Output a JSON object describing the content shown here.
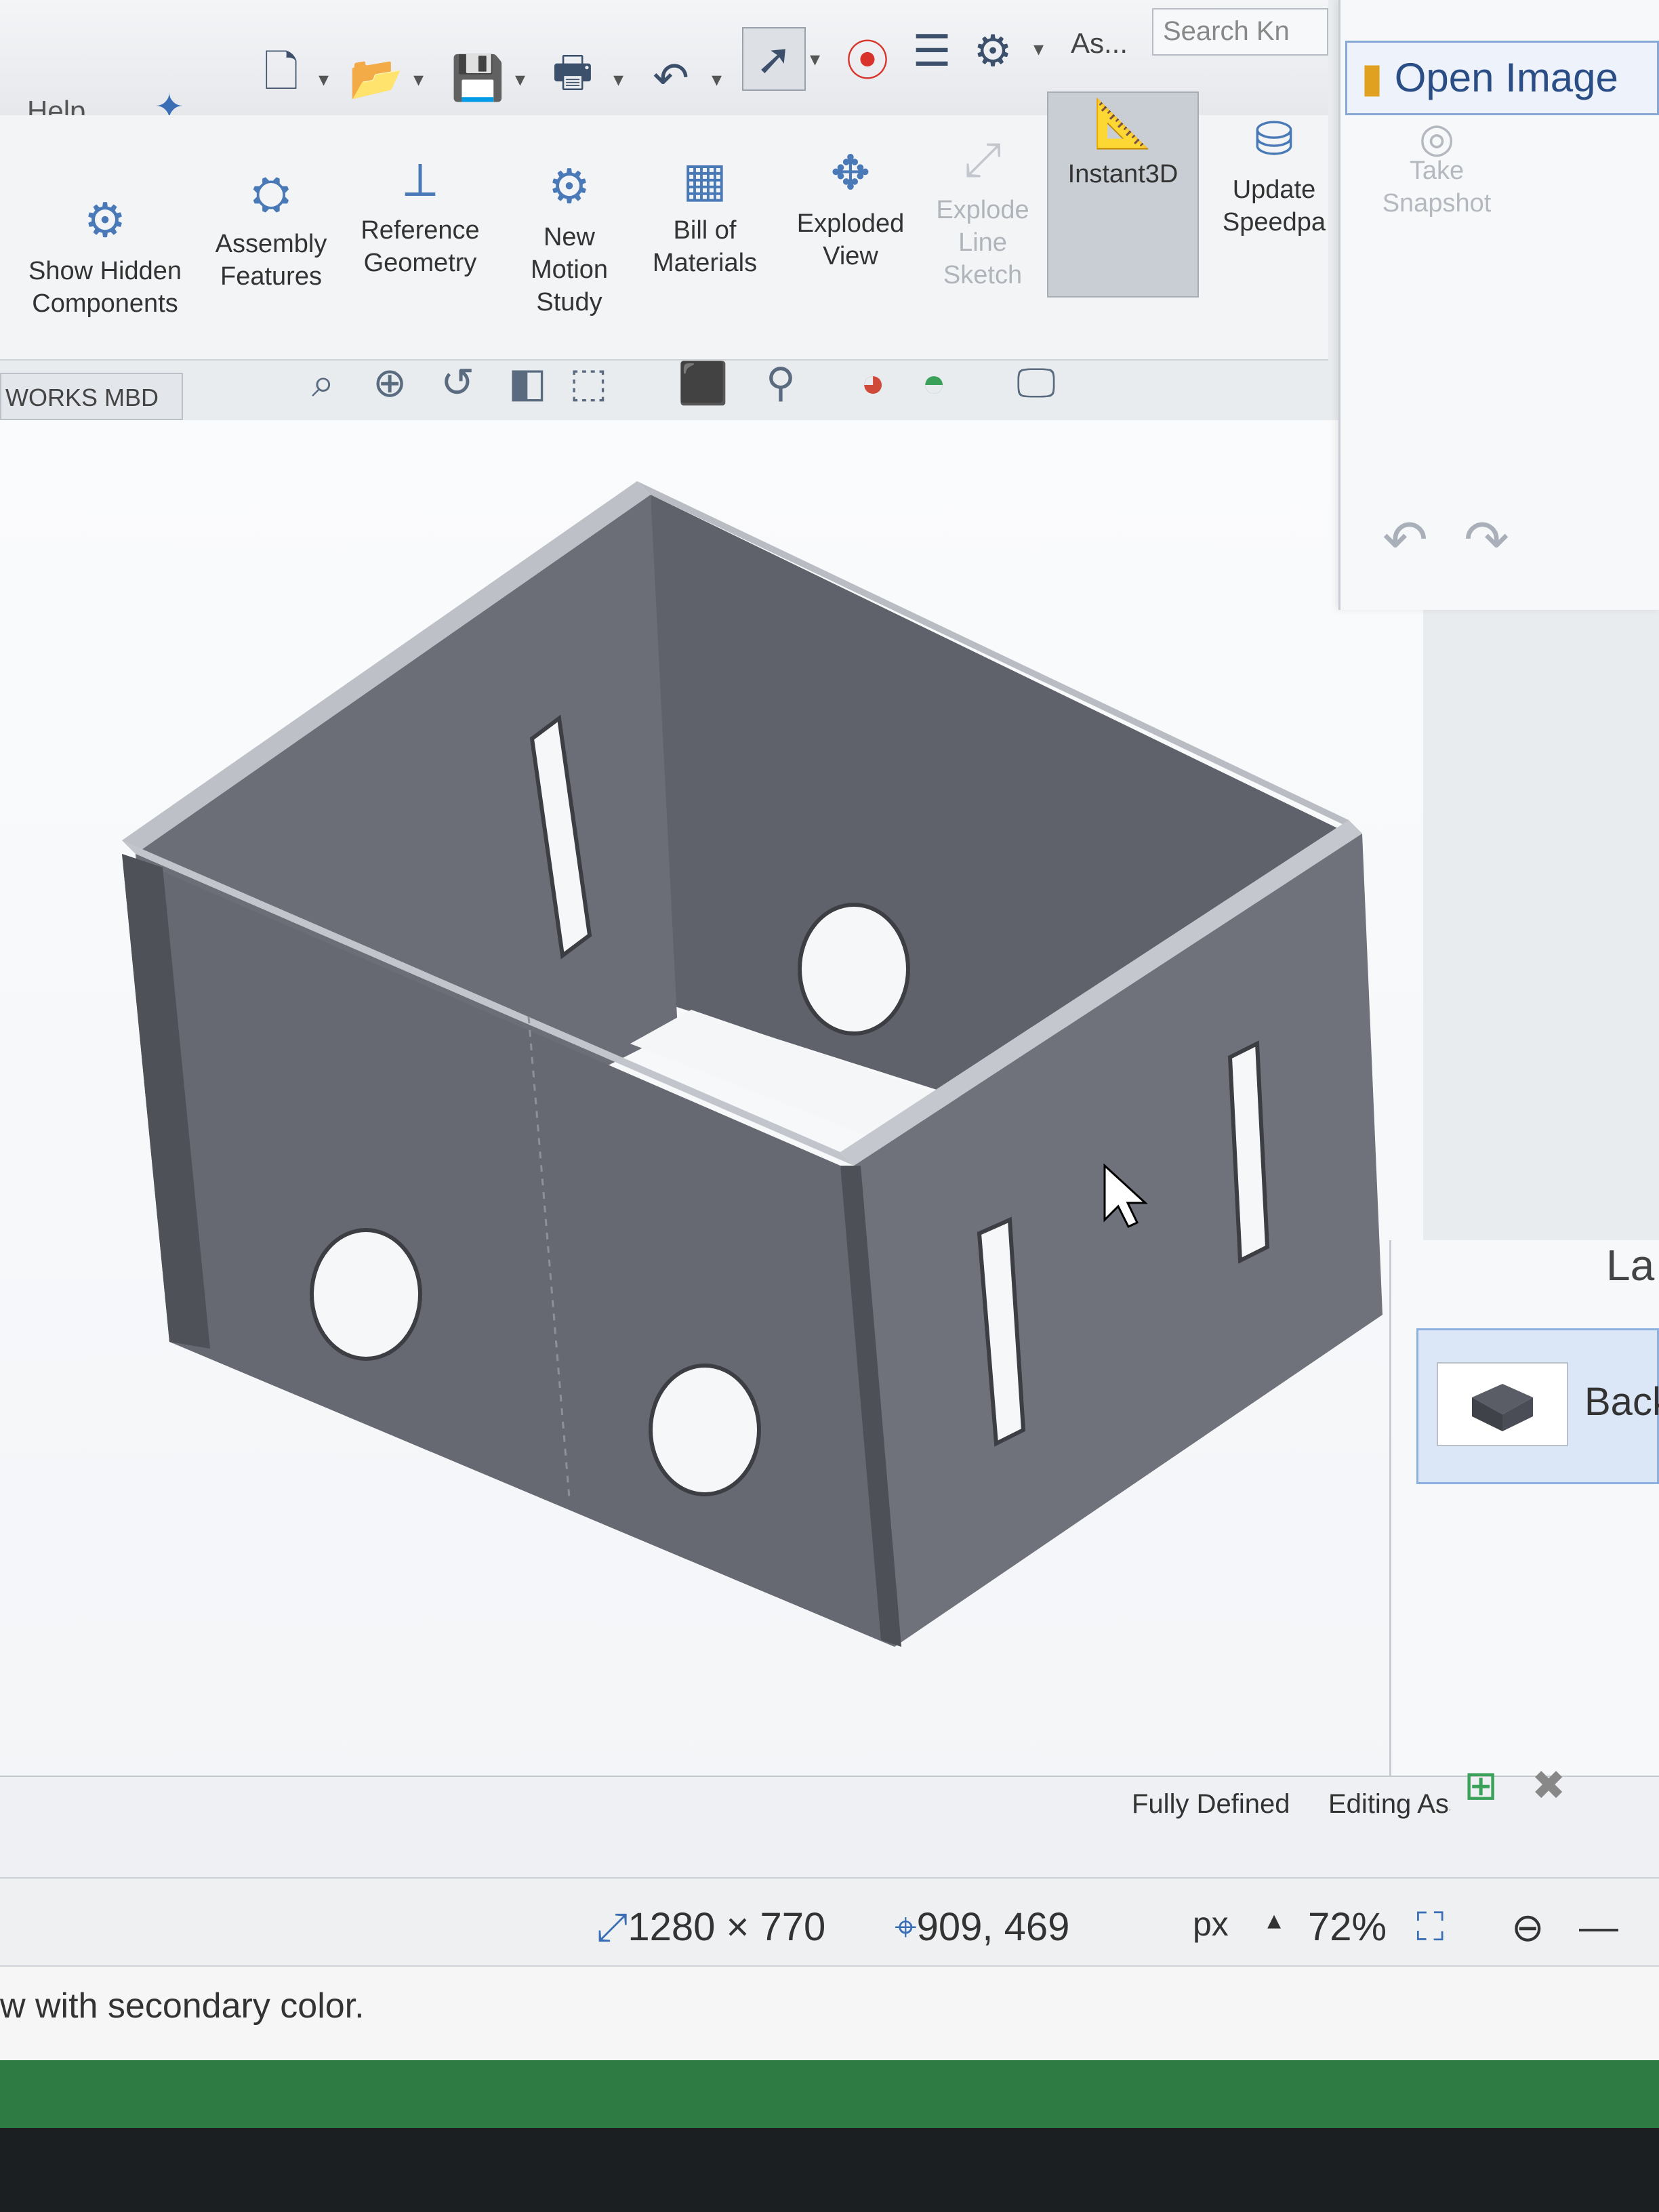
{
  "quick_access": {
    "help_label": "Help",
    "ask_label": "As...",
    "search_placeholder": "Search Kn"
  },
  "ribbon": {
    "items": [
      {
        "label": "Show Hidden Components"
      },
      {
        "label": "Assembly Features"
      },
      {
        "label": "Reference Geometry"
      },
      {
        "label": "New Motion Study"
      },
      {
        "label": "Bill of Materials"
      },
      {
        "label": "Exploded View"
      },
      {
        "label": "Explode Line Sketch"
      },
      {
        "label": "Instant3D"
      },
      {
        "label": "Update Speedpa"
      }
    ]
  },
  "tabs": {
    "mbd_label": "WORKS MBD"
  },
  "side_panel": {
    "open_image_label": "Open Image",
    "take_snapshot_label": "Take Snapshot"
  },
  "layers_panel": {
    "title": "La",
    "item_label": "Back"
  },
  "model_status": {
    "fully_defined": "Fully Defined",
    "editing": "Editing Assembly"
  },
  "paint_status": {
    "dimensions": "1280 × 770",
    "cursor_pos": "909, 469",
    "unit": "px",
    "zoom": "72%"
  },
  "status_hint": "w with secondary color.",
  "colors": {
    "model_face": "#6d7079",
    "model_edge": "#b6b9bf",
    "accent": "#3a6fb6"
  }
}
